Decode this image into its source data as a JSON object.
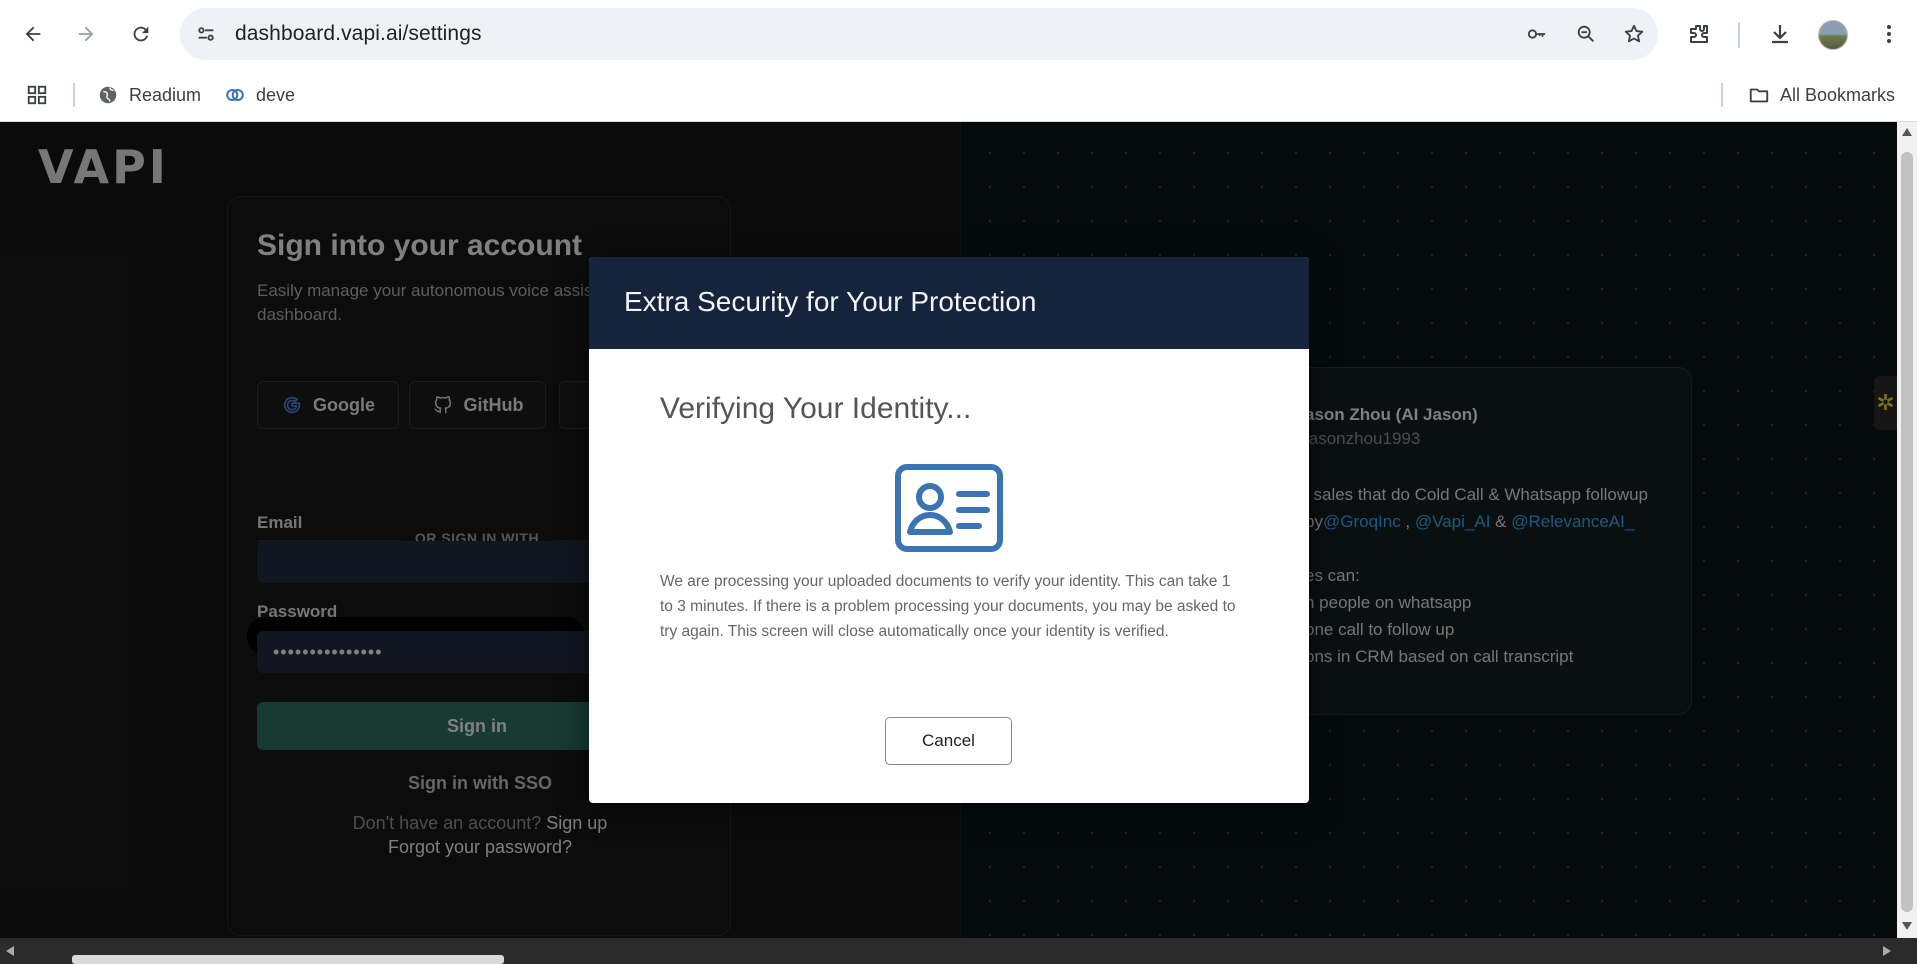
{
  "browser": {
    "url": "dashboard.vapi.ai/settings",
    "bookmarks": [
      {
        "label": "Readium"
      },
      {
        "label": "deve"
      }
    ],
    "all_bookmarks_label": "All Bookmarks"
  },
  "page": {
    "logo": "VAPI",
    "signin": {
      "title": "Sign into your account",
      "subtitle": "Easily manage your autonomous voice assista dashboard.",
      "google_label": "Google",
      "github_label": "GitHub",
      "divider": "OR SIGN IN WITH",
      "email_label": "Email",
      "password_label": "Password",
      "password_value": "•••••••••••••••",
      "signin_button": "Sign in",
      "sso_link": "Sign in with SSO",
      "no_account": "Don't have an account?",
      "signup_link": "Sign up",
      "forgot_link": "Forgot your password?"
    },
    "testimonial": {
      "name": "ason Zhou (AI Jason)",
      "handle": "jasonzhou1993",
      "line1": "l sales that do Cold Call & Whatsapp followup",
      "line2_prefix": "by",
      "mention1": "@GroqInc",
      "sep1": " , ",
      "mention2": "@Vapi_AI",
      "sep2": " & ",
      "mention3": "@RelevanceAI_",
      "line3": "es can:",
      "line4": "n people on whatsapp",
      "line5": "one call to follow up",
      "line6": "ons in CRM based on call transcript"
    }
  },
  "modal": {
    "title": "Extra Security for Your Protection",
    "heading": "Verifying Your Identity...",
    "icon": "id-card-icon",
    "body": "We are processing your uploaded documents to verify your identity. This can take 1 to 3 minutes. If there is a problem processing your documents, you may be asked to try again. This screen will close automatically once your identity is verified.",
    "cancel_label": "Cancel"
  },
  "colors": {
    "modal_header": "#15243a",
    "signin_button": "#2b6b5f",
    "mention": "#3aa0e8",
    "id_icon": "#3a74b2"
  }
}
